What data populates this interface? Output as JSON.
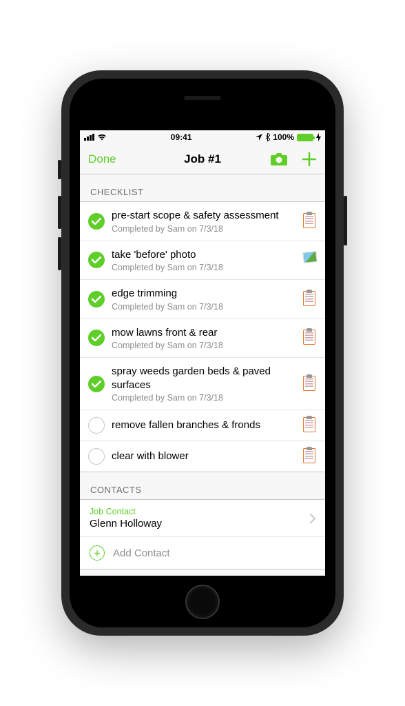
{
  "status": {
    "time": "09:41",
    "battery": "100%"
  },
  "nav": {
    "done": "Done",
    "title": "Job #1"
  },
  "sections": {
    "checklist": "CHECKLIST",
    "contacts": "CONTACTS"
  },
  "checklist": [
    {
      "title": "pre-start scope & safety assessment",
      "meta": "Completed by Sam on 7/3/18",
      "done": true,
      "icon": "clipboard"
    },
    {
      "title": "take 'before' photo",
      "meta": "Completed by Sam on 7/3/18",
      "done": true,
      "icon": "photo"
    },
    {
      "title": "edge trimming",
      "meta": "Completed by Sam on 7/3/18",
      "done": true,
      "icon": "clipboard"
    },
    {
      "title": "mow lawns front & rear",
      "meta": "Completed by Sam on 7/3/18",
      "done": true,
      "icon": "clipboard"
    },
    {
      "title": "spray weeds  garden beds & paved surfaces",
      "meta": "Completed by Sam on 7/3/18",
      "done": true,
      "icon": "clipboard"
    },
    {
      "title": "remove fallen branches & fronds",
      "meta": "",
      "done": false,
      "icon": "clipboard"
    },
    {
      "title": "clear with blower",
      "meta": "",
      "done": false,
      "icon": "clipboard"
    }
  ],
  "contact": {
    "label": "Job Contact",
    "name": "Glenn Holloway"
  },
  "add_contact": "Add Contact",
  "colors": {
    "accent": "#5fce29"
  }
}
